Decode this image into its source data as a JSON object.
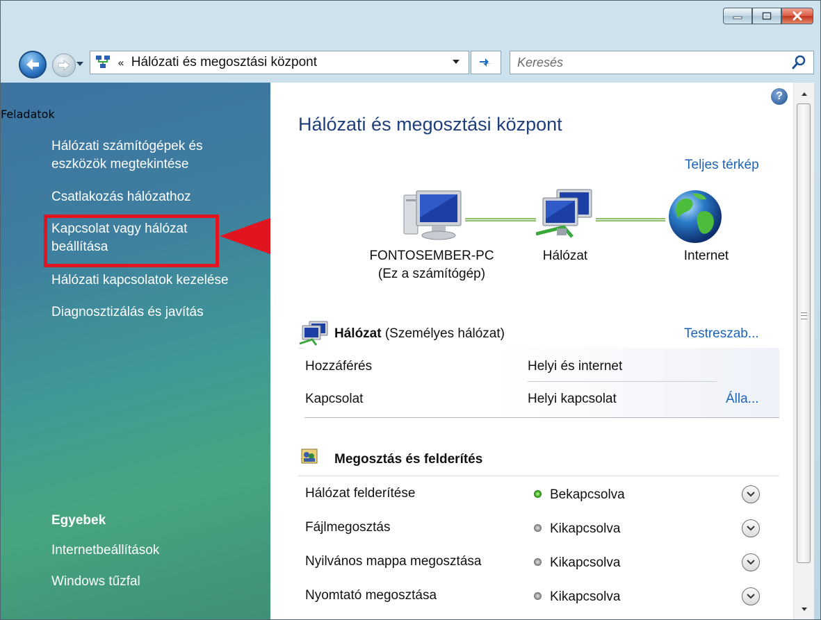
{
  "address": {
    "chevron": "«",
    "path": "Hálózati és megosztási központ",
    "search_placeholder": "Keresés"
  },
  "sidebar": {
    "tasks_heading": "Feladatok",
    "tasks": [
      "Hálózati számítógépek és eszközök megtekintése",
      "Csatlakozás hálózathoz",
      "Kapcsolat vagy hálózat beállítása",
      "Hálózati kapcsolatok kezelése",
      "Diagnosztizálás és javítás"
    ],
    "other_heading": "Egyebek",
    "other": [
      "Internetbeállítások",
      "Windows tűzfal"
    ]
  },
  "main": {
    "title": "Hálózati és megosztási központ",
    "full_map_link": "Teljes térkép",
    "map": {
      "computer_name": "FONTOSEMBER-PC",
      "computer_sub": "(Ez a számítógép)",
      "network_label": "Hálózat",
      "internet_label": "Internet"
    },
    "network_section": {
      "name": "Hálózat",
      "type": "(Személyes hálózat)",
      "customize_link": "Testreszab...",
      "rows": [
        {
          "label": "Hozzáférés",
          "value": "Helyi és internet",
          "action": ""
        },
        {
          "label": "Kapcsolat",
          "value": "Helyi kapcsolat",
          "action": "Álla..."
        }
      ]
    },
    "sharing_section": {
      "title": "Megosztás és felderítés",
      "rows": [
        {
          "label": "Hálózat felderítése",
          "value": "Bekapcsolva",
          "state": "on"
        },
        {
          "label": "Fájlmegosztás",
          "value": "Kikapcsolva",
          "state": "off"
        },
        {
          "label": "Nyilvános mappa megosztása",
          "value": "Kikapcsolva",
          "state": "off"
        },
        {
          "label": "Nyomtató megosztása",
          "value": "Kikapcsolva",
          "state": "off"
        }
      ]
    }
  },
  "colors": {
    "highlight_box": "#e0151f",
    "link": "#1a64b8",
    "title": "#1e3f7a"
  }
}
